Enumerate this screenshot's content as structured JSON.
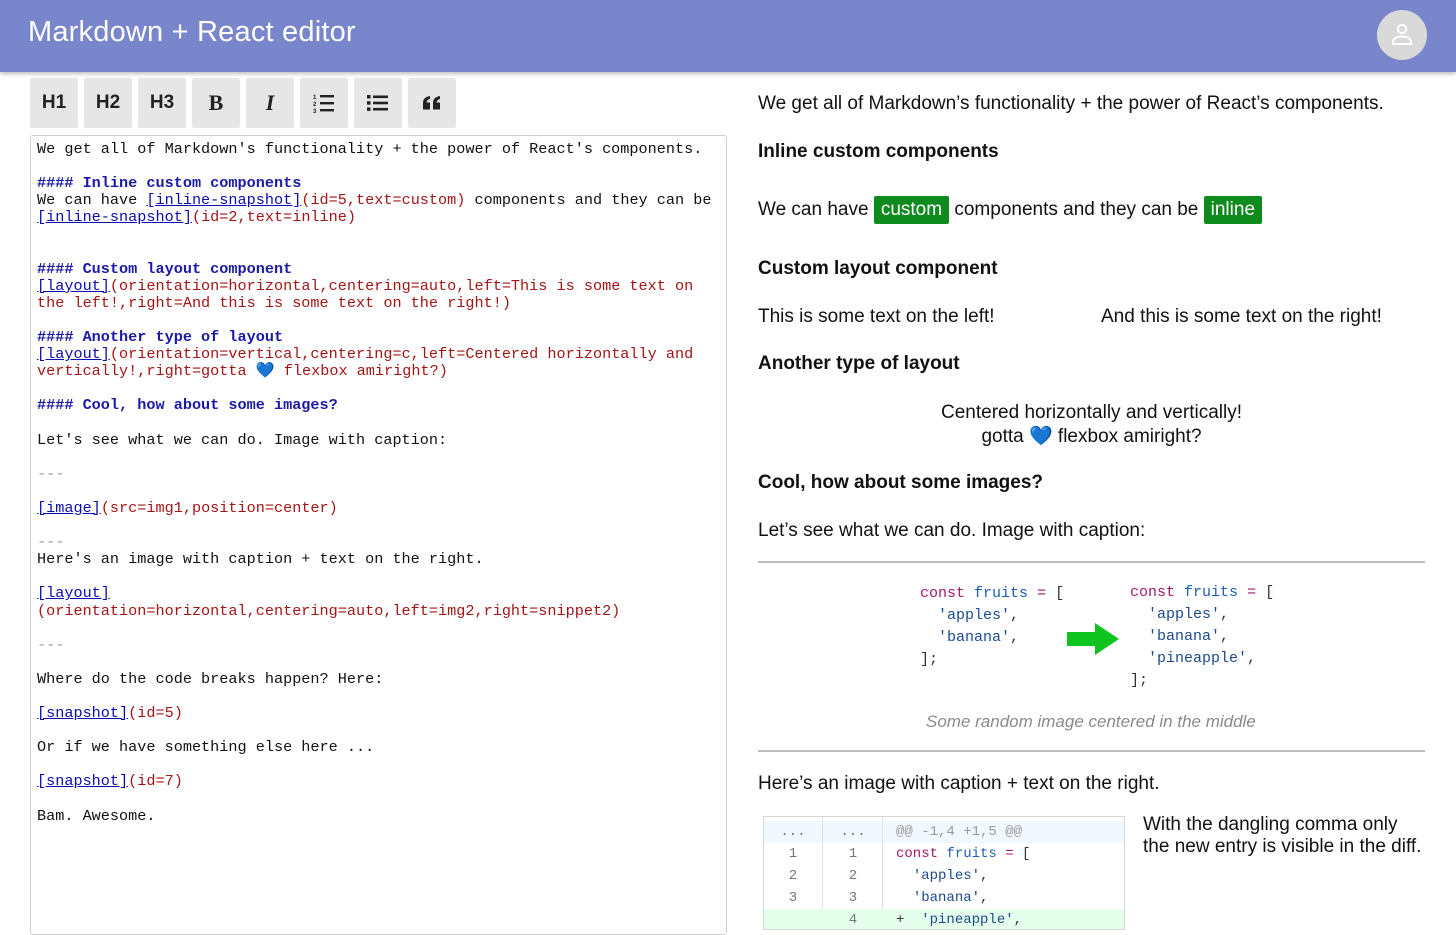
{
  "app": {
    "title": "Markdown + React editor",
    "avatar_icon": "person-icon"
  },
  "toolbar": {
    "h1": "H1",
    "h2": "H2",
    "h3": "H3",
    "bold": "B",
    "italic": "I",
    "ordered_list_icon": "ordered-list-icon",
    "unordered_list_icon": "unordered-list-icon",
    "quote_icon": "quote-icon"
  },
  "editor": {
    "lines": [
      [
        {
          "t": "We get all of Markdown's functionality + the power of React's components.",
          "c": ""
        }
      ],
      [
        {
          "t": "",
          "c": ""
        }
      ],
      [
        {
          "t": "#### Inline custom components",
          "c": "hd"
        }
      ],
      [
        {
          "t": "We can have ",
          "c": ""
        },
        {
          "t": "[inline-snapshot]",
          "c": "lk"
        },
        {
          "t": "(id=5,text=custom)",
          "c": "pr"
        },
        {
          "t": " components and they can be ",
          "c": ""
        },
        {
          "t": "[inline-snapshot]",
          "c": "lk"
        },
        {
          "t": "(id=2,text=inline)",
          "c": "pr"
        }
      ],
      [
        {
          "t": "",
          "c": ""
        }
      ],
      [
        {
          "t": "",
          "c": ""
        }
      ],
      [
        {
          "t": "#### Custom layout component",
          "c": "hd"
        }
      ],
      [
        {
          "t": "[layout]",
          "c": "lk"
        },
        {
          "t": "(orientation=horizontal,centering=auto,left=This is some text on the left!,right=And this is some text on the right!)",
          "c": "pr"
        }
      ],
      [
        {
          "t": "",
          "c": ""
        }
      ],
      [
        {
          "t": "#### Another type of layout",
          "c": "hd"
        }
      ],
      [
        {
          "t": "[layout]",
          "c": "lk"
        },
        {
          "t": "(orientation=vertical,centering=c,left=Centered horizontally and vertically!,right=gotta 💙 flexbox amiright?)",
          "c": "pr"
        }
      ],
      [
        {
          "t": "",
          "c": ""
        }
      ],
      [
        {
          "t": "#### Cool, how about some images?",
          "c": "hd"
        }
      ],
      [
        {
          "t": "",
          "c": ""
        }
      ],
      [
        {
          "t": "Let's see what we can do. Image with caption:",
          "c": ""
        }
      ],
      [
        {
          "t": "",
          "c": ""
        }
      ],
      [
        {
          "t": "---",
          "c": "hr"
        }
      ],
      [
        {
          "t": "",
          "c": ""
        }
      ],
      [
        {
          "t": "[image]",
          "c": "lk"
        },
        {
          "t": "(src=img1,position=center)",
          "c": "pr"
        }
      ],
      [
        {
          "t": "",
          "c": ""
        }
      ],
      [
        {
          "t": "---",
          "c": "hr"
        }
      ],
      [
        {
          "t": "Here's an image with caption + text on the right.",
          "c": ""
        }
      ],
      [
        {
          "t": "",
          "c": ""
        }
      ],
      [
        {
          "t": "[layout]",
          "c": "lk"
        }
      ],
      [
        {
          "t": "(orientation=horizontal,centering=auto,left=img2,right=snippet2)",
          "c": "pr"
        }
      ],
      [
        {
          "t": "",
          "c": ""
        }
      ],
      [
        {
          "t": "---",
          "c": "hr"
        }
      ],
      [
        {
          "t": "",
          "c": ""
        }
      ],
      [
        {
          "t": "Where do the code breaks happen? Here:",
          "c": ""
        }
      ],
      [
        {
          "t": "",
          "c": ""
        }
      ],
      [
        {
          "t": "[snapshot]",
          "c": "lk"
        },
        {
          "t": "(id=5)",
          "c": "pr"
        }
      ],
      [
        {
          "t": "",
          "c": ""
        }
      ],
      [
        {
          "t": "Or if we have something else here ...",
          "c": ""
        }
      ],
      [
        {
          "t": "",
          "c": ""
        }
      ],
      [
        {
          "t": "[snapshot]",
          "c": "lk"
        },
        {
          "t": "(id=7)",
          "c": "pr"
        }
      ],
      [
        {
          "t": "",
          "c": ""
        }
      ],
      [
        {
          "t": "Bam. Awesome.",
          "c": ""
        }
      ]
    ]
  },
  "preview": {
    "intro": "We get all of Markdown’s functionality + the power of React’s components.",
    "h_inline": "Inline custom components",
    "inline_before": "We can have ",
    "pill_custom": "custom",
    "inline_middle": " components and they can be ",
    "pill_inline": "inline",
    "h_custom_layout": "Custom layout component",
    "left_text": "This is some text on the left!",
    "right_text": "And this is some text on the right!",
    "h_another": "Another type of layout",
    "centered_1": "Centered horizontally and vertically!",
    "centered_2_a": "gotta ",
    "centered_2_emoji": "💙",
    "centered_2_b": " flexbox amiright?",
    "h_images": "Cool, how about some images?",
    "images_intro": "Let’s see what we can do. Image with caption:",
    "img1": {
      "left_code": [
        "const fruits = [",
        "  'apples',",
        "  'banana',",
        "];"
      ],
      "right_code": [
        "const fruits = [",
        "  'apples',",
        "  'banana',",
        "  'pineapple',",
        "];"
      ],
      "arrow_icon": "right-arrow-icon",
      "arrow_color": "#0fc41f",
      "caption": "Some random image centered in the middle"
    },
    "img2_intro": "Here’s an image with caption + text on the right.",
    "diff": {
      "header": {
        "a": "...",
        "b": "...",
        "hunk": "@@ -1,4 +1,5 @@"
      },
      "rows": [
        {
          "a": "1",
          "b": "1",
          "code": "const fruits = ["
        },
        {
          "a": "2",
          "b": "2",
          "code": "  'apples',"
        },
        {
          "a": "3",
          "b": "3",
          "code": "  'banana',"
        },
        {
          "a": "",
          "b": "4",
          "code": "+  'pineapple',"
        }
      ]
    },
    "side_text": "With the dangling comma only the new entry is visible in the diff."
  },
  "colors": {
    "appbar": "#7986cb",
    "pill": "#0f8a1c",
    "heading_md": "#1a1aa6",
    "link_md": "#0b0bb3",
    "param_md": "#a31515"
  }
}
